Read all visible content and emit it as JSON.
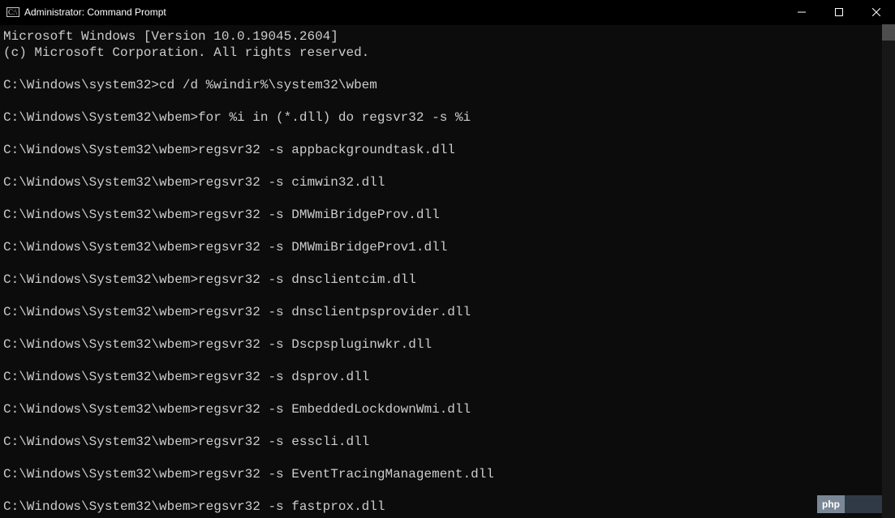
{
  "titlebar": {
    "title": "Administrator: Command Prompt"
  },
  "window_controls": {
    "minimize": "minimize",
    "maximize": "maximize",
    "close": "close"
  },
  "lines": [
    "Microsoft Windows [Version 10.0.19045.2604]",
    "(c) Microsoft Corporation. All rights reserved.",
    "",
    "C:\\Windows\\system32>cd /d %windir%\\system32\\wbem",
    "",
    "C:\\Windows\\System32\\wbem>for %i in (*.dll) do regsvr32 -s %i",
    "",
    "C:\\Windows\\System32\\wbem>regsvr32 -s appbackgroundtask.dll",
    "",
    "C:\\Windows\\System32\\wbem>regsvr32 -s cimwin32.dll",
    "",
    "C:\\Windows\\System32\\wbem>regsvr32 -s DMWmiBridgeProv.dll",
    "",
    "C:\\Windows\\System32\\wbem>regsvr32 -s DMWmiBridgeProv1.dll",
    "",
    "C:\\Windows\\System32\\wbem>regsvr32 -s dnsclientcim.dll",
    "",
    "C:\\Windows\\System32\\wbem>regsvr32 -s dnsclientpsprovider.dll",
    "",
    "C:\\Windows\\System32\\wbem>regsvr32 -s Dscpspluginwkr.dll",
    "",
    "C:\\Windows\\System32\\wbem>regsvr32 -s dsprov.dll",
    "",
    "C:\\Windows\\System32\\wbem>regsvr32 -s EmbeddedLockdownWmi.dll",
    "",
    "C:\\Windows\\System32\\wbem>regsvr32 -s esscli.dll",
    "",
    "C:\\Windows\\System32\\wbem>regsvr32 -s EventTracingManagement.dll",
    "",
    "C:\\Windows\\System32\\wbem>regsvr32 -s fastprox.dll"
  ],
  "watermark": {
    "left": "php",
    "right": ""
  }
}
